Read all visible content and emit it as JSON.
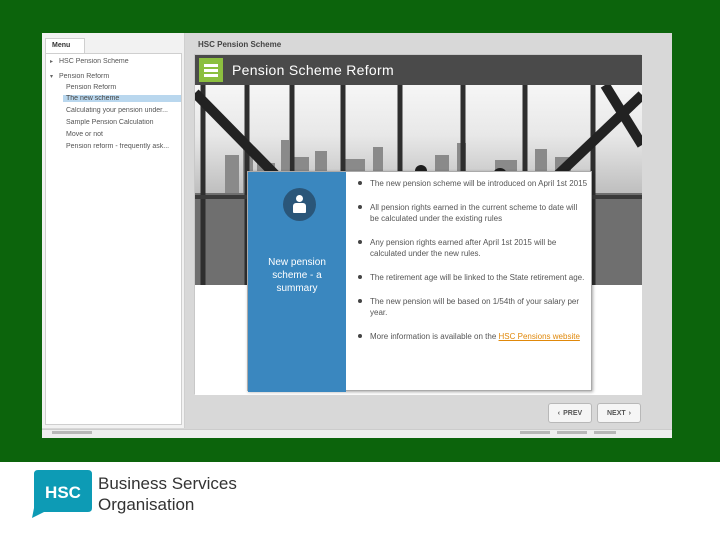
{
  "sidebar": {
    "tab_label": "Menu",
    "items": [
      {
        "label": "HSC Pension Scheme"
      },
      {
        "label": "Pension Reform"
      }
    ],
    "sub_items": [
      {
        "label": "Pension Reform"
      },
      {
        "label": "The new scheme"
      },
      {
        "label": "Calculating your pension under..."
      },
      {
        "label": "Sample Pension Calculation"
      },
      {
        "label": "Move or not"
      },
      {
        "label": "Pension reform - frequently ask..."
      }
    ]
  },
  "content": {
    "title": "HSC Pension Scheme",
    "header_title": "Pension Scheme Reform",
    "summary_title": "New pension scheme - a summary",
    "bullets": [
      "The new pension scheme will be introduced on April 1st 2015",
      "All pension rights earned in the current scheme to date will be calculated under the existing rules",
      "Any pension rights earned after April 1st 2015 will be calculated under the new rules.",
      "The retirement age will be linked to the State retirement age.",
      "The new pension will be based on 1/54th of your salary per year."
    ],
    "more_info_prefix": "More information is available on the",
    "more_info_link": "HSC Pensions website"
  },
  "nav": {
    "prev_label": "PREV",
    "next_label": "NEXT",
    "prev_icon": "chevron-left-icon",
    "next_icon": "chevron-right-icon"
  },
  "logo": {
    "mark_text": "HSC",
    "line1": "Business Services",
    "line2": "Organisation"
  },
  "colors": {
    "background_green": "#0c640c",
    "header_accent": "#8cbf3f",
    "summary_blue": "#3a87bf",
    "link_orange": "#e0880a",
    "logo_teal": "#0d9bb5"
  }
}
